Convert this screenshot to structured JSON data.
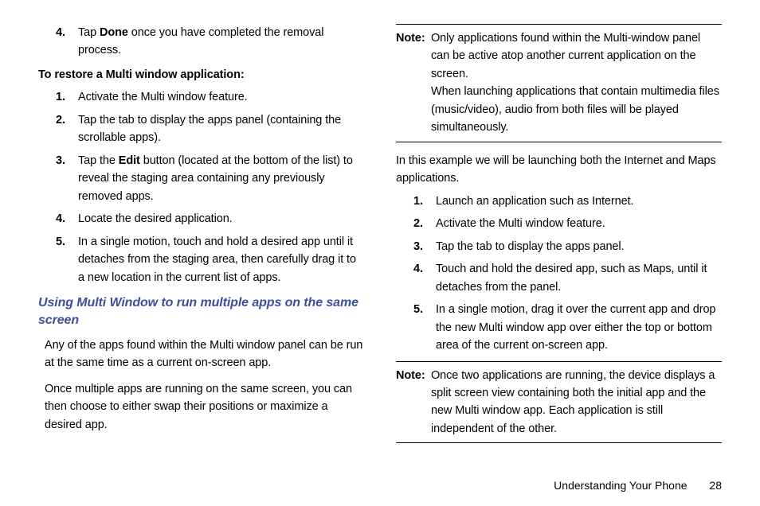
{
  "left": {
    "prevStep": {
      "marker": "4.",
      "text_a": "Tap ",
      "done": "Done",
      "text_b": " once you have completed the removal process."
    },
    "restoreHead": "To restore a Multi window application:",
    "restore": [
      {
        "marker": "1.",
        "text": "Activate the Multi window feature."
      },
      {
        "marker": "2.",
        "text": "Tap the tab to display the apps panel (containing the scrollable apps)."
      },
      {
        "marker": "3.",
        "text_a": "Tap the ",
        "edit": "Edit",
        "text_b": " button (located at the bottom of the list) to reveal the staging area containing any previously removed apps."
      },
      {
        "marker": "4.",
        "text": "Locate the desired application."
      },
      {
        "marker": "5.",
        "text": "In a single motion, touch and hold a desired app until it detaches from the staging area, then carefully drag it to a new location in the current list of apps."
      }
    ],
    "heading": "Using Multi Window to run multiple apps on the same screen",
    "p1": "Any of the apps found within the Multi window panel can be run at the same time as a current on-screen app.",
    "p2": "Once multiple apps are running on the same screen, you can then choose to either swap their positions or maximize a desired app."
  },
  "right": {
    "note1Label": "Note:",
    "note1a": "Only applications found within the Multi-window panel can be active atop another current application on the screen.",
    "note1b": "When launching applications that contain multimedia files (music/video), audio from both files will be played simultaneously.",
    "p1": "In this example we will be launching both the Internet and Maps applications.",
    "steps": [
      {
        "marker": "1.",
        "text": "Launch an application such as Internet."
      },
      {
        "marker": "2.",
        "text": "Activate the Multi window feature."
      },
      {
        "marker": "3.",
        "text": "Tap the tab to display the apps panel."
      },
      {
        "marker": "4.",
        "text": "Touch and hold the desired app, such as Maps, until it detaches from the panel."
      },
      {
        "marker": "5.",
        "text": "In a single motion, drag it over the current app and drop the new Multi window app over either the top or bottom area of the current on-screen app."
      }
    ],
    "note2Label": "Note:",
    "note2": "Once two applications are running, the device displays a split screen view containing both the initial app and the new Multi window app. Each application is still independent of the other."
  },
  "footer": {
    "section": "Understanding Your Phone",
    "page": "28"
  }
}
